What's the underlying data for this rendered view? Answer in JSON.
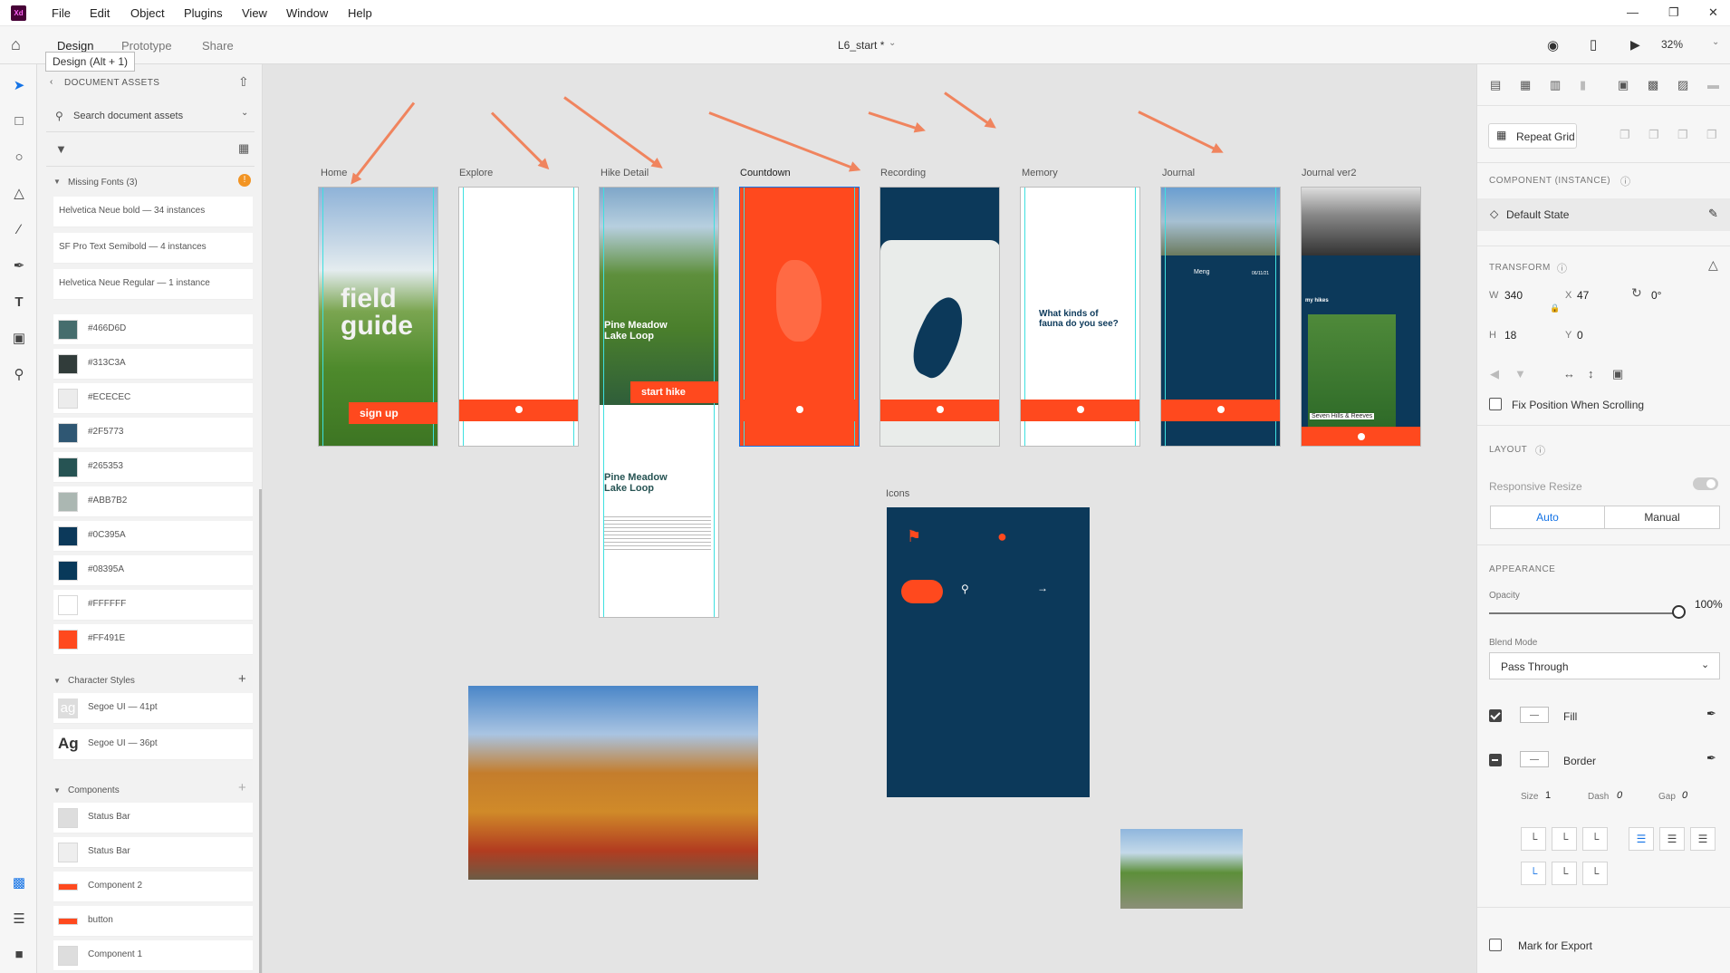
{
  "menubar": {
    "logo": "Xd",
    "items": [
      "File",
      "Edit",
      "Object",
      "Plugins",
      "View",
      "Window",
      "Help"
    ]
  },
  "modes": {
    "design": "Design",
    "prototype": "Prototype",
    "share": "Share",
    "doc_title": "L6_start *",
    "zoom": "32%"
  },
  "tooltip": "Design (Alt + 1)",
  "assets": {
    "title": "DOCUMENT ASSETS",
    "search_placeholder": "Search document assets",
    "missing_fonts_header": "Missing Fonts (3)",
    "missing_fonts": [
      "Helvetica Neue bold — 34 instances",
      "SF Pro Text Semibold — 4 instances",
      "Helvetica Neue Regular — 1 instance"
    ],
    "colors": [
      {
        "hex": "#466D6D"
      },
      {
        "hex": "#313C3A"
      },
      {
        "hex": "#ECECEC"
      },
      {
        "hex": "#2F5773"
      },
      {
        "hex": "#265353"
      },
      {
        "hex": "#ABB7B2"
      },
      {
        "hex": "#0C395A"
      },
      {
        "hex": "#08395A"
      },
      {
        "hex": "#FFFFFF"
      },
      {
        "hex": "#FF491E"
      }
    ],
    "char_styles_header": "Character Styles",
    "char_styles": [
      {
        "sample": "ag",
        "label": "Segoe UI — 41pt"
      },
      {
        "sample": "Ag",
        "label": "Segoe UI — 36pt"
      }
    ],
    "components_header": "Components",
    "components": [
      "Status Bar",
      "Status Bar",
      "Component 2",
      "button",
      "Component 1"
    ]
  },
  "canvas": {
    "artboards": [
      "Home",
      "Explore",
      "Hike Detail",
      "Countdown",
      "Recording",
      "Memory",
      "Journal",
      "Journal ver2"
    ],
    "icons_label": "Icons",
    "home": {
      "title_line1": "field",
      "title_line2": "guide",
      "cta": "sign up"
    },
    "hike": {
      "title_line1": "Pine Meadow",
      "title_line2": "Lake Loop",
      "cta": "start hike",
      "subtitle_line1": "Pine Meadow",
      "subtitle_line2": "Lake Loop"
    },
    "memory": {
      "question_line1": "What kinds of",
      "question_line2": "fauna do you see?"
    },
    "journal": {
      "name": "Meng",
      "date": "06/11/21"
    },
    "journal2": {
      "heading": "my hikes",
      "card": "Seven Hills & Reeves"
    }
  },
  "props": {
    "repeat_grid": "Repeat Grid",
    "component_header": "COMPONENT (INSTANCE)",
    "state": "Default State",
    "transform_header": "TRANSFORM",
    "w_label": "W",
    "w": "340",
    "x_label": "X",
    "x": "47",
    "rot": "0°",
    "h_label": "H",
    "h": "18",
    "y_label": "Y",
    "y": "0",
    "fix_position": "Fix Position When Scrolling",
    "layout_header": "LAYOUT",
    "responsive": "Responsive Resize",
    "auto": "Auto",
    "manual": "Manual",
    "appearance_header": "APPEARANCE",
    "opacity_label": "Opacity",
    "opacity": "100%",
    "opacity_level": 1.0,
    "blend_label": "Blend Mode",
    "blend": "Pass Through",
    "fill": "Fill",
    "border": "Border",
    "size_label": "Size",
    "size": "1",
    "dash_label": "Dash",
    "dash": "0",
    "gap_label": "Gap",
    "gap": "0",
    "export": "Mark for Export"
  },
  "colors": {
    "accent": "#FF491E",
    "navy": "#0C395A",
    "selection": "#1473E6"
  }
}
